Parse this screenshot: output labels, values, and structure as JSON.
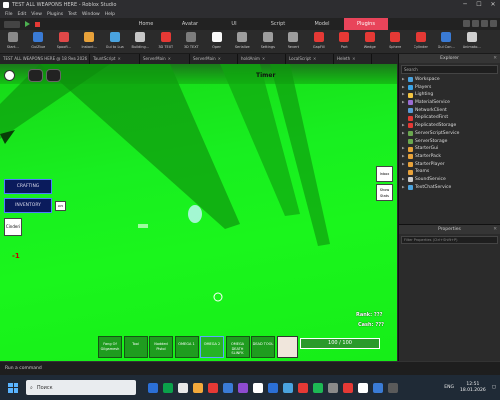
{
  "window": {
    "title": "TEST ALL WEAPONS HERE - Roblox Studio"
  },
  "menu": [
    "File",
    "Edit",
    "View",
    "Plugins",
    "Test",
    "Window",
    "Help"
  ],
  "ribbon_tabs": [
    {
      "label": "Home"
    },
    {
      "label": "Avatar"
    },
    {
      "label": "UI"
    },
    {
      "label": "Script"
    },
    {
      "label": "Model"
    },
    {
      "label": "Plugins",
      "active": true
    }
  ],
  "toolbar": [
    {
      "label": "Start...",
      "icon": "start-icon",
      "color": "#8a8a8a"
    },
    {
      "label": "GuiZtue",
      "icon": "gui-icon",
      "color": "#3a7bd5"
    },
    {
      "label": "Spoofi...",
      "icon": "spoof-icon",
      "color": "#e04848"
    },
    {
      "label": "Instant...",
      "icon": "instant-icon",
      "color": "#e8a23a"
    },
    {
      "label": "Gui to Lua",
      "icon": "gui-lua-icon",
      "color": "#4aa3df"
    },
    {
      "label": "Building...",
      "icon": "building-icon",
      "color": "#c8c8c8"
    },
    {
      "label": "3D TEXT",
      "icon": "3d-text-icon",
      "color": "#e53935"
    },
    {
      "label": "3D TEXT",
      "icon": "3d-text-icon-2",
      "color": "#7d7d7d"
    },
    {
      "label": "Open",
      "icon": "github-icon",
      "color": "#fafafa"
    },
    {
      "label": "Serialize",
      "icon": "serialize-icon",
      "color": "#9e9e9e"
    },
    {
      "label": "Settings",
      "icon": "settings-icon",
      "color": "#9e9e9e"
    },
    {
      "label": "Revert",
      "icon": "revert-icon",
      "color": "#9e9e9e"
    },
    {
      "label": "GapFill",
      "icon": "gapfill-icon",
      "color": "#e53935"
    },
    {
      "label": "Part",
      "icon": "part-icon",
      "color": "#e53935"
    },
    {
      "label": "Wedge",
      "icon": "wedge-icon",
      "color": "#e53935"
    },
    {
      "label": "Sphere",
      "icon": "sphere-icon",
      "color": "#e53935"
    },
    {
      "label": "Cylinder",
      "icon": "cylinder-icon",
      "color": "#e53935"
    },
    {
      "label": "Gui Con...",
      "icon": "gui-con-icon",
      "color": "#3a7bd5"
    },
    {
      "label": "Animato...",
      "icon": "animator-icon",
      "color": "#d0d0d0"
    }
  ],
  "doc_tabs": [
    {
      "label": "TEST ALL WEAPONS HERE @ 18 Янв 2026 12:49"
    },
    {
      "label": "TauntScript"
    },
    {
      "label": "ServerMain"
    },
    {
      "label": "ServerMain"
    },
    {
      "label": "holdAnim"
    },
    {
      "label": "LocalScript"
    },
    {
      "label": "Heleth"
    }
  ],
  "viewport": {
    "timer_label": "Timer",
    "crafting_label": "CRAFTING",
    "inventory_label": "INVENTORY",
    "menu_button": "Cinderi",
    "small_badge": "LV5",
    "right_btn_1": "Inbox",
    "right_btn_2": "Show Stats",
    "damage_text": "-1",
    "health_text": "100 / 100",
    "health_fraction": 1.0,
    "rank_label": "Rank: ???",
    "cash_label": "Cash: ???"
  },
  "hotbar": [
    {
      "label": "Fang Of Gilgamesh"
    },
    {
      "label": "Tool"
    },
    {
      "label": "Nodded Pistol"
    },
    {
      "label": "OMEGA 1"
    },
    {
      "label": "OMEGA 2",
      "selected": true
    },
    {
      "label": "OMEGA DEATH SLINFK"
    },
    {
      "label": "DEAD TOOL"
    }
  ],
  "explorer": {
    "title": "Explorer",
    "search_placeholder": "Search",
    "items": [
      {
        "label": "Workspace",
        "color": "#4aa3df",
        "arrow": "▶"
      },
      {
        "label": "Players",
        "color": "#3aa4e8",
        "arrow": "▶"
      },
      {
        "label": "Lighting",
        "color": "#f4c542",
        "arrow": "▶"
      },
      {
        "label": "MaterialService",
        "color": "#9c6dd4",
        "arrow": "▶"
      },
      {
        "label": "NetworkClient",
        "color": "#5b9bd5",
        "arrow": ""
      },
      {
        "label": "ReplicatedFirst",
        "color": "#e53935",
        "arrow": ""
      },
      {
        "label": "ReplicatedStorage",
        "color": "#e53935",
        "arrow": "▶"
      },
      {
        "label": "ServerScriptService",
        "color": "#6aa84f",
        "arrow": "▶"
      },
      {
        "label": "ServerStorage",
        "color": "#6aa84f",
        "arrow": ""
      },
      {
        "label": "StarterGui",
        "color": "#e8a23a",
        "arrow": "▶"
      },
      {
        "label": "StarterPack",
        "color": "#e8a23a",
        "arrow": "▶"
      },
      {
        "label": "StarterPlayer",
        "color": "#e8a23a",
        "arrow": "▶"
      },
      {
        "label": "Teams",
        "color": "#e8a23a",
        "arrow": ""
      },
      {
        "label": "SoundService",
        "color": "#cccccc",
        "arrow": "▶"
      },
      {
        "label": "TextChatService",
        "color": "#4aa3df",
        "arrow": "▶"
      }
    ]
  },
  "properties": {
    "title": "Properties",
    "filter_placeholder": "Filter Properties (Ctrl+Shift+P)"
  },
  "command_bar": {
    "placeholder": "Run a command"
  },
  "taskbar": {
    "search_text": "Поиск",
    "time": "12:51",
    "date": "18.01.2026",
    "lang": "ENG"
  },
  "taskbar_apps": [
    "#2b6fd6",
    "#0aa14a",
    "#e8e8e8",
    "#f2a93b",
    "#e53935",
    "#3a7bd5",
    "#8e4bd0",
    "#fff",
    "#2b6fd6",
    "#4aa3df",
    "#e53935",
    "#1db954",
    "#8a8a8a",
    "#e53935",
    "#ffffff",
    "#3a7bd5",
    "#5a5a5a"
  ]
}
